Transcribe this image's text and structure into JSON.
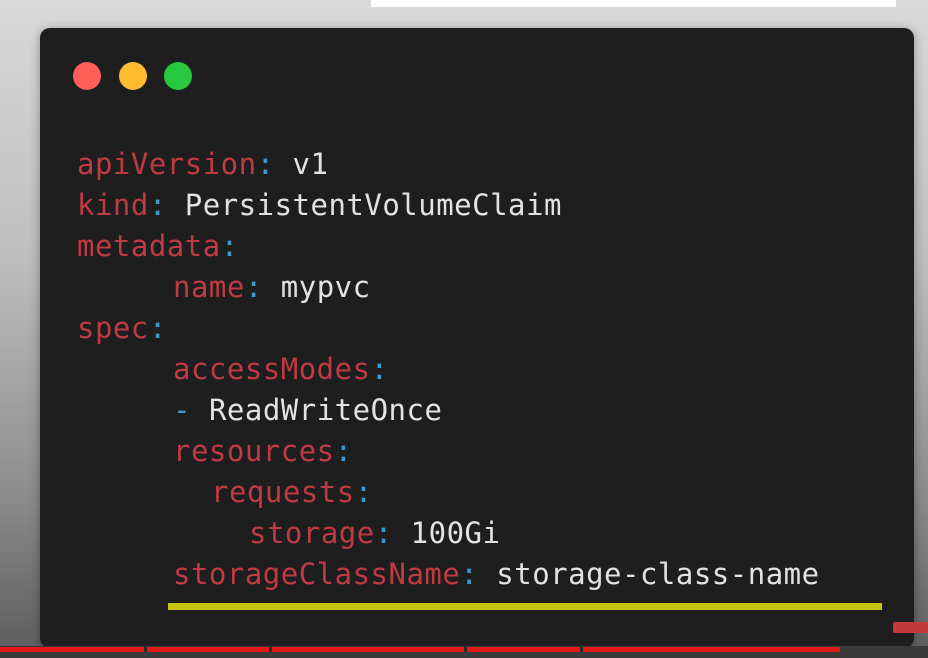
{
  "window": {
    "traffic_lights": [
      {
        "name": "close",
        "color": "#ff5f57"
      },
      {
        "name": "minimize",
        "color": "#febc2e"
      },
      {
        "name": "maximize",
        "color": "#28c840"
      }
    ]
  },
  "code": {
    "lines": [
      {
        "indent": 0,
        "key": "apiVersion",
        "sep": ":",
        "value": "v1"
      },
      {
        "indent": 0,
        "key": "kind",
        "sep": ":",
        "value": "PersistentVolumeClaim"
      },
      {
        "indent": 0,
        "key": "metadata",
        "sep": ":",
        "value": ""
      },
      {
        "indent": 1,
        "key": "name",
        "sep": ":",
        "value": "mypvc"
      },
      {
        "indent": 0,
        "key": "spec",
        "sep": ":",
        "value": ""
      },
      {
        "indent": 1,
        "key": "accessModes",
        "sep": ":",
        "value": ""
      },
      {
        "indent": 1,
        "dash": "-",
        "value": "ReadWriteOnce"
      },
      {
        "indent": 1,
        "key": "resources",
        "sep": ":",
        "value": ""
      },
      {
        "indent": 2,
        "key": "requests",
        "sep": ":",
        "value": ""
      },
      {
        "indent": 3,
        "key": "storage",
        "sep": ":",
        "value": "100Gi"
      },
      {
        "indent": 1,
        "key": "storageClassName",
        "sep": ":",
        "value": "storage-class-name"
      }
    ],
    "key_color": "#bf3a42",
    "punct_color": "#3a9bd3",
    "highlighted_line": "storageClassName"
  },
  "video": {
    "progress": 0.905,
    "chapter_marks": [
      0.155,
      0.29,
      0.5,
      0.625
    ]
  }
}
